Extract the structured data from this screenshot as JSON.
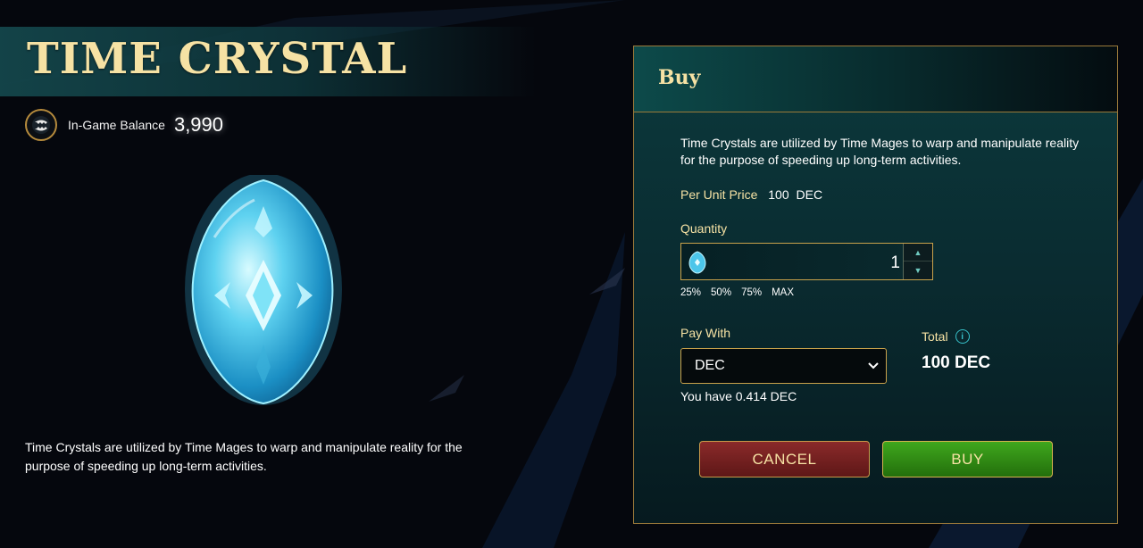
{
  "item": {
    "title": "TIME CRYSTAL",
    "description": "Time Crystals are utilized by Time Mages to warp and manipulate reality for the purpose of speeding up long-term activities.",
    "image_icon": "time-crystal-gem"
  },
  "balance": {
    "icon": "merit-coin-icon",
    "label": "In-Game Balance",
    "value": "3,990"
  },
  "buy_panel": {
    "title": "Buy",
    "description": "Time Crystals are utilized by Time Mages to warp and manipulate reality for the purpose of speeding up long-term activities.",
    "per_unit_label": "Per Unit Price",
    "per_unit_value": "100",
    "per_unit_currency": "DEC",
    "quantity_label": "Quantity",
    "quantity_value": "1",
    "percent_options": [
      "25%",
      "50%",
      "75%",
      "MAX"
    ],
    "pay_with_label": "Pay With",
    "pay_with_selected": "DEC",
    "you_have": "You have 0.414 DEC",
    "total_label": "Total",
    "total_value": "100 DEC",
    "cancel_label": "CANCEL",
    "buy_label": "BUY"
  },
  "colors": {
    "gold": "#f6e2a4",
    "border_gold": "#c9a24b",
    "teal": "#37c0c9",
    "cancel_red": "#7a2222",
    "buy_green": "#35961a"
  }
}
